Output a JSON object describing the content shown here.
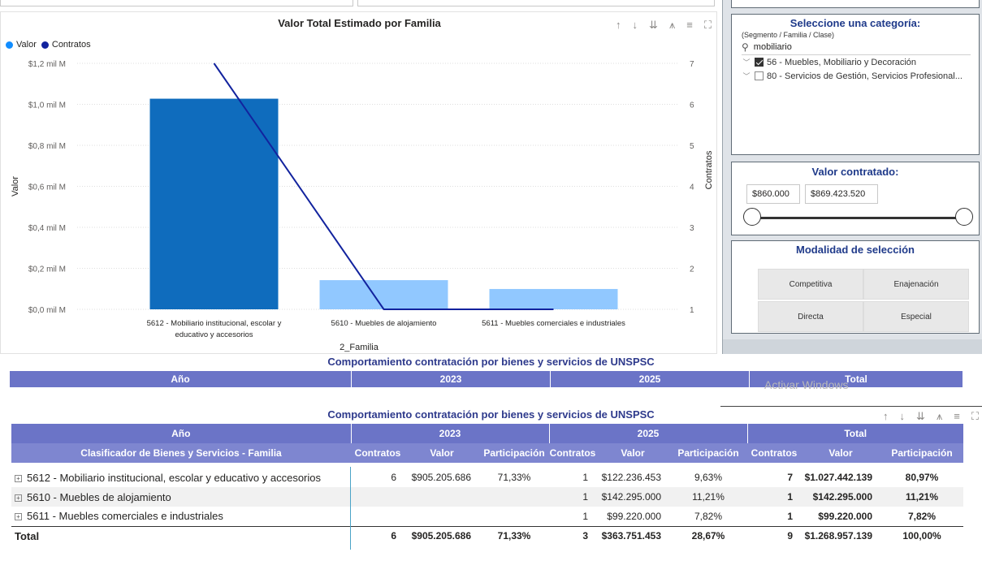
{
  "chart": {
    "title": "Valor Total Estimado por Familia",
    "legend": [
      {
        "label": "Valor",
        "color": "#118dff"
      },
      {
        "label": "Contratos",
        "color": "#12239e"
      }
    ],
    "icons": [
      "arrow-up-icon",
      "arrow-down-icon",
      "double-arrow-down-icon",
      "hierarchy-icon",
      "filter-icon",
      "focus-mode-icon"
    ]
  },
  "chart_data": {
    "type": "bar",
    "title": "Valor Total Estimado por Familia",
    "xlabel": "2_Familia",
    "ylabel": "Valor",
    "y2label": "Contratos",
    "categories": [
      "5612 - Mobiliario institucional, escolar y educativo y accesorios",
      "5610 - Muebles de alojamiento",
      "5611 - Muebles comerciales e industriales"
    ],
    "category_lines": [
      [
        "5612 - Mobiliario institucional, escolar y",
        "educativo y accesorios"
      ],
      [
        "5610 - Muebles de alojamiento"
      ],
      [
        "5611 - Muebles comerciales e industriales"
      ]
    ],
    "series": [
      {
        "name": "Valor",
        "type": "bar",
        "values": [
          1027442139,
          142295000,
          99220000
        ],
        "colors": [
          "#0f6cbd",
          "#91c8ff",
          "#91c8ff"
        ]
      },
      {
        "name": "Contratos",
        "type": "line",
        "axis": "right",
        "values": [
          7,
          1,
          1
        ],
        "color": "#12239e"
      }
    ],
    "ylim": [
      0,
      1200000000
    ],
    "y_ticks": [
      "$0,0 mil M",
      "$0,2 mil M",
      "$0,4 mil M",
      "$0,6 mil M",
      "$0,8 mil M",
      "$1,0 mil M",
      "$1,2 mil M"
    ],
    "y2lim": [
      1,
      7
    ],
    "y2_ticks": [
      "1",
      "2",
      "3",
      "4",
      "5",
      "6",
      "7"
    ],
    "grid": true,
    "legend_position": "top-left"
  },
  "categoria": {
    "title": "Seleccione una categoría:",
    "subtitle": "(Segmento / Familia / Clase)",
    "search_value": "mobiliario",
    "items": [
      {
        "label": "56 - Muebles, Mobiliario y Decoración",
        "checked": true
      },
      {
        "label": "80 - Servicios de Gestión, Servicios Profesional...",
        "checked": false
      }
    ]
  },
  "valor_contratado": {
    "title": "Valor contratado:",
    "min": "$860.000",
    "max": "$869.423.520"
  },
  "modalidad": {
    "title": "Modalidad de selección",
    "options": [
      "Competitiva",
      "Enajenación",
      "Directa",
      "Especial"
    ]
  },
  "partial_header": {
    "title": "Comportamiento contratación por bienes y servicios de UNSPSC",
    "year_label": "Año",
    "y2023": "2023",
    "y2025": "2025",
    "total": "Total"
  },
  "watermark": "Activar Windows",
  "matrix": {
    "title": "Comportamiento contratación por bienes y servicios de UNSPSC",
    "year_label": "Año",
    "years": [
      "2023",
      "2025",
      "Total"
    ],
    "row_header": "Clasificador de Bienes y Servicios - Familia",
    "col_headers": [
      "Contratos",
      "Valor",
      "Participación",
      "Contratos",
      "Valor",
      "Participación",
      "Contratos",
      "Valor",
      "Participación"
    ],
    "rows": [
      {
        "familia": "5612 - Mobiliario institucional, escolar y educativo y accesorios",
        "c2023": "6",
        "v2023": "$905.205.686",
        "p2023": "71,33%",
        "c2025": "1",
        "v2025": "$122.236.453",
        "p2025": "9,63%",
        "ct": "7",
        "vt": "$1.027.442.139",
        "pt": "80,97%"
      },
      {
        "familia": "5610 - Muebles de alojamiento",
        "c2023": "",
        "v2023": "",
        "p2023": "",
        "c2025": "1",
        "v2025": "$142.295.000",
        "p2025": "11,21%",
        "ct": "1",
        "vt": "$142.295.000",
        "pt": "11,21%"
      },
      {
        "familia": "5611 - Muebles comerciales e industriales",
        "c2023": "",
        "v2023": "",
        "p2023": "",
        "c2025": "1",
        "v2025": "$99.220.000",
        "p2025": "7,82%",
        "ct": "1",
        "vt": "$99.220.000",
        "pt": "7,82%"
      }
    ],
    "total": {
      "familia": "Total",
      "c2023": "6",
      "v2023": "$905.205.686",
      "p2023": "71,33%",
      "c2025": "3",
      "v2025": "$363.751.453",
      "p2025": "28,67%",
      "ct": "9",
      "vt": "$1.268.957.139",
      "pt": "100,00%"
    }
  }
}
